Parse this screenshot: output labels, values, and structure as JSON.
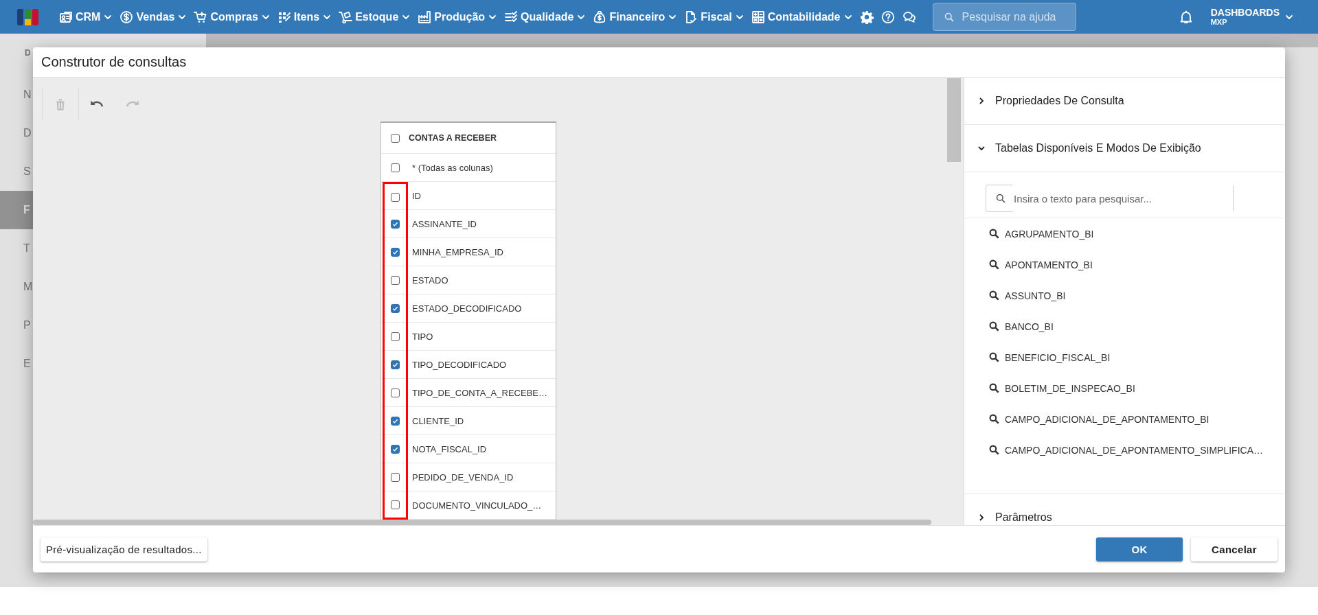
{
  "top_nav": {
    "menus": [
      {
        "label": "CRM"
      },
      {
        "label": "Vendas"
      },
      {
        "label": "Compras"
      },
      {
        "label": "Itens"
      },
      {
        "label": "Estoque"
      },
      {
        "label": "Produção"
      },
      {
        "label": "Qualidade"
      },
      {
        "label": "Financeiro"
      },
      {
        "label": "Fiscal"
      },
      {
        "label": "Contabilidade"
      }
    ],
    "search": {
      "placeholder": "Pesquisar na ajuda"
    },
    "account": {
      "title": "DASHBOARDS",
      "subtitle": "MXP"
    }
  },
  "background_sidebar": {
    "heading": "D",
    "items": [
      {
        "label": "N",
        "selected": false
      },
      {
        "label": "D",
        "selected": false
      },
      {
        "label": "S",
        "selected": false
      },
      {
        "label": "F",
        "selected": true
      },
      {
        "label": "T",
        "selected": false
      },
      {
        "label": "M",
        "selected": false
      },
      {
        "label": "P",
        "selected": false
      },
      {
        "label": "E",
        "selected": false
      }
    ]
  },
  "dialog": {
    "title": "Construtor de consultas",
    "toolbar": [
      {
        "kind": "delete",
        "disabled": true
      },
      {
        "kind": "undo",
        "disabled": false
      },
      {
        "kind": "redo",
        "disabled": true
      }
    ],
    "table": {
      "title": "CONTAS A RECEBER",
      "checked": false,
      "columns": [
        {
          "label": "* (Todas as colunas)",
          "checked": false,
          "highlighted": false
        },
        {
          "label": "ID",
          "checked": false,
          "highlighted": true
        },
        {
          "label": "ASSINANTE_ID",
          "checked": true,
          "highlighted": true
        },
        {
          "label": "MINHA_EMPRESA_ID",
          "checked": true,
          "highlighted": true
        },
        {
          "label": "ESTADO",
          "checked": false,
          "highlighted": true
        },
        {
          "label": "ESTADO_DECODIFICADO",
          "checked": true,
          "highlighted": true
        },
        {
          "label": "TIPO",
          "checked": false,
          "highlighted": true
        },
        {
          "label": "TIPO_DECODIFICADO",
          "checked": true,
          "highlighted": true
        },
        {
          "label": "TIPO_DE_CONTA_A_RECEBE…",
          "checked": false,
          "highlighted": true
        },
        {
          "label": "CLIENTE_ID",
          "checked": true,
          "highlighted": true
        },
        {
          "label": "NOTA_FISCAL_ID",
          "checked": true,
          "highlighted": true
        },
        {
          "label": "PEDIDO_DE_VENDA_ID",
          "checked": false,
          "highlighted": true
        },
        {
          "label": "DOCUMENTO_VINCULADO_…",
          "checked": false,
          "highlighted": true
        }
      ]
    },
    "side_panel": {
      "sections": [
        {
          "title": "Propriedades De Consulta",
          "expanded": false
        },
        {
          "title": "Tabelas Disponíveis E Modos De Exibição",
          "expanded": true,
          "search": {
            "placeholder": "Insira o texto para pesquisar..."
          },
          "items": [
            {
              "label": "AGRUPAMENTO_BI"
            },
            {
              "label": "APONTAMENTO_BI"
            },
            {
              "label": "ASSUNTO_BI"
            },
            {
              "label": "BANCO_BI"
            },
            {
              "label": "BENEFICIO_FISCAL_BI"
            },
            {
              "label": "BOLETIM_DE_INSPECAO_BI"
            },
            {
              "label": "CAMPO_ADICIONAL_DE_APONTAMENTO_BI"
            },
            {
              "label": "CAMPO_ADICIONAL_DE_APONTAMENTO_SIMPLIFICA…"
            }
          ]
        },
        {
          "title": "Parâmetros",
          "expanded": false
        }
      ]
    },
    "buttons": [
      {
        "label": "Pré-visualização de resultados...",
        "kind": "secondary"
      },
      {
        "label": "OK",
        "kind": "primary"
      },
      {
        "label": "Cancelar",
        "kind": "secondary"
      }
    ]
  }
}
